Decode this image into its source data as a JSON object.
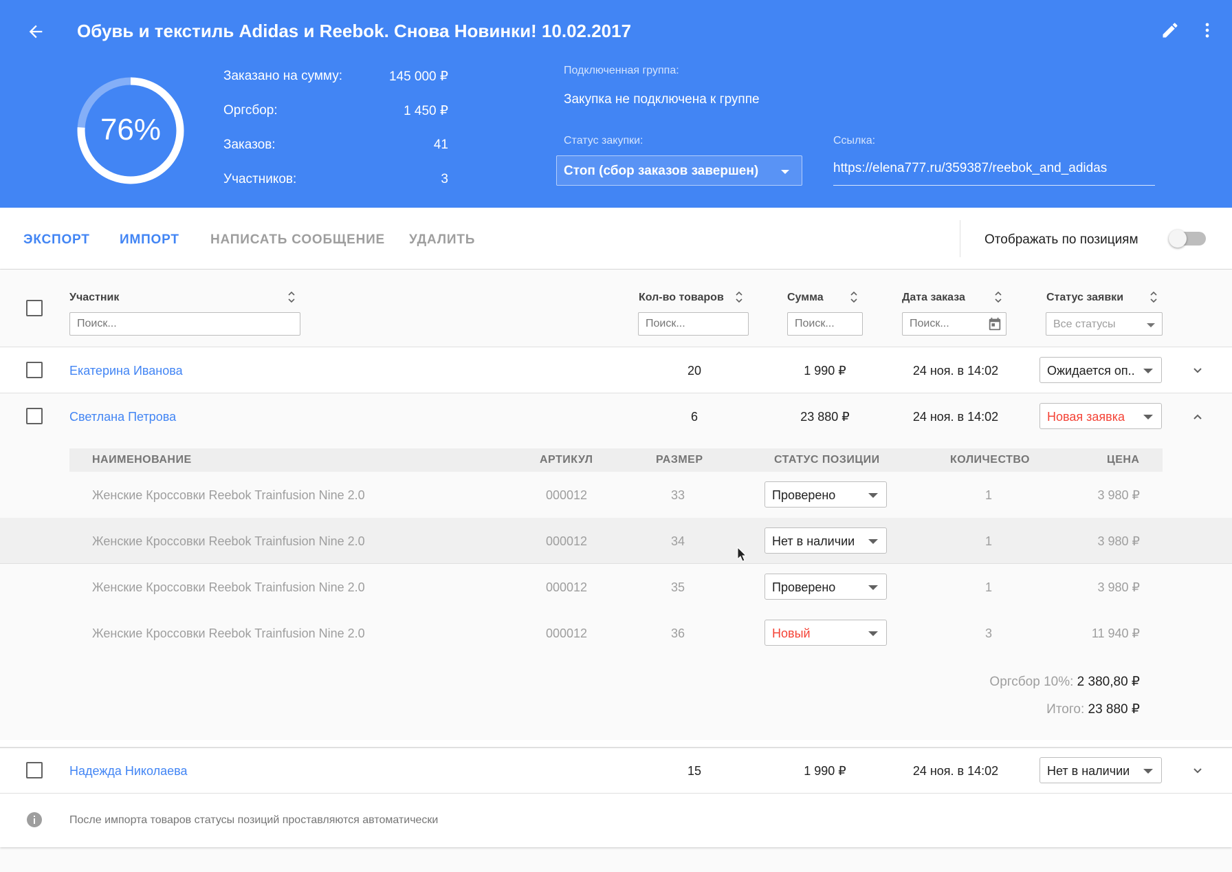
{
  "header": {
    "title": "Обувь и текстиль Adidas и Reebok. Снова Новинки! 10.02.2017",
    "progress_label": "76%",
    "progress_value": 0.76,
    "stats": [
      {
        "label": "Заказано на сумму:",
        "value": "145 000 ₽"
      },
      {
        "label": "Оргсбор:",
        "value": "1 450 ₽"
      },
      {
        "label": "Заказов:",
        "value": "41"
      },
      {
        "label": "Участников:",
        "value": "3"
      }
    ],
    "group_caption": "Подключенная группа:",
    "group_value": "Закупка не подключена к группе",
    "status_caption": "Статус закупки:",
    "status_value": "Стоп (сбор заказов завершен)",
    "link_caption": "Ссылка:",
    "link_value": "https://elena777.ru/359387/reebok_and_adidas"
  },
  "toolbar": {
    "export": "ЭКСПОРТ",
    "import": "ИМПОРТ",
    "message": "НАПИСАТЬ СООБЩЕНИЕ",
    "delete": "УДАЛИТЬ",
    "toggle_label": "Отображать по позициям",
    "toggle_on": false
  },
  "columns": {
    "participant": "Участник",
    "qty": "Кол-во товаров",
    "sum": "Сумма",
    "date": "Дата заказа",
    "status": "Статус заявки",
    "search_placeholder": "Поиск...",
    "status_filter": "Все статусы"
  },
  "rows": [
    {
      "name": "Екатерина Иванова",
      "qty": "20",
      "sum": "1 990 ₽",
      "date": "24 ноя. в 14:02",
      "status": "Ожидается оп..",
      "status_color": "#212121"
    },
    {
      "name": "Светлана Петрова",
      "qty": "6",
      "sum": "23 880 ₽",
      "date": "24 ноя. в 14:02",
      "status": "Новая заявка",
      "status_color": "#f44336"
    },
    {
      "name": "Надежда Николаева",
      "qty": "15",
      "sum": "1 990 ₽",
      "date": "24 ноя. в 14:02",
      "status": "Нет в наличии",
      "status_color": "#212121"
    }
  ],
  "subtable": {
    "headers": {
      "name": "НАИМЕНОВАНИЕ",
      "article": "АРТИКУЛ",
      "size": "РАЗМЕР",
      "status": "СТАТУС ПОЗИЦИИ",
      "count": "КОЛИЧЕСТВО",
      "price": "ЦЕНА"
    },
    "items": [
      {
        "name": "Женские Кроссовки Reebok Trainfusion Nine 2.0",
        "article": "000012",
        "size": "33",
        "status": "Проверено",
        "status_color": "#212121",
        "count": "1",
        "price": "3 980 ₽"
      },
      {
        "name": "Женские Кроссовки Reebok Trainfusion Nine 2.0",
        "article": "000012",
        "size": "34",
        "status": "Нет в наличии",
        "status_color": "#212121",
        "count": "1",
        "price": "3 980 ₽"
      },
      {
        "name": "Женские Кроссовки Reebok Trainfusion Nine 2.0",
        "article": "000012",
        "size": "35",
        "status": "Проверено",
        "status_color": "#212121",
        "count": "1",
        "price": "3 980 ₽"
      },
      {
        "name": "Женские Кроссовки Reebok Trainfusion Nine 2.0",
        "article": "000012",
        "size": "36",
        "status": "Новый",
        "status_color": "#f44336",
        "count": "3",
        "price": "11 940 ₽"
      }
    ],
    "fee_label": "Оргсбор 10%:",
    "fee_value": "2 380,80 ₽",
    "total_label": "Итого:",
    "total_value": "23 880 ₽"
  },
  "footer_note": "После импорта товаров статусы позиций проставляются автоматически",
  "colors": {
    "accent": "#4285f4",
    "danger": "#f44336"
  }
}
